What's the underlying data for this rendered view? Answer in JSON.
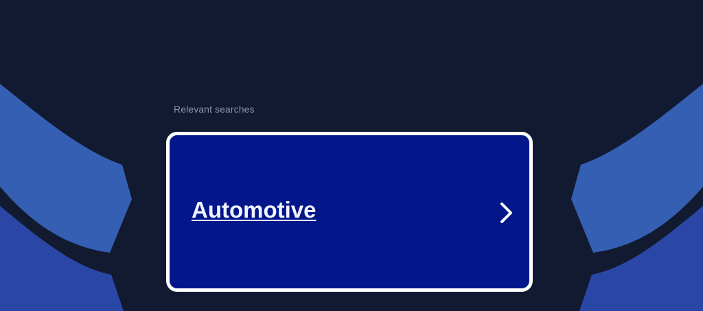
{
  "section": {
    "label": "Relevant searches"
  },
  "results": [
    {
      "label": "Automotive",
      "icon": "chevron-right-icon"
    }
  ],
  "colors": {
    "background": "#111a30",
    "card": "#03178a",
    "card_border": "#ffffff",
    "wing_light": "#355fb2",
    "wing_dark": "#2a47a5"
  }
}
